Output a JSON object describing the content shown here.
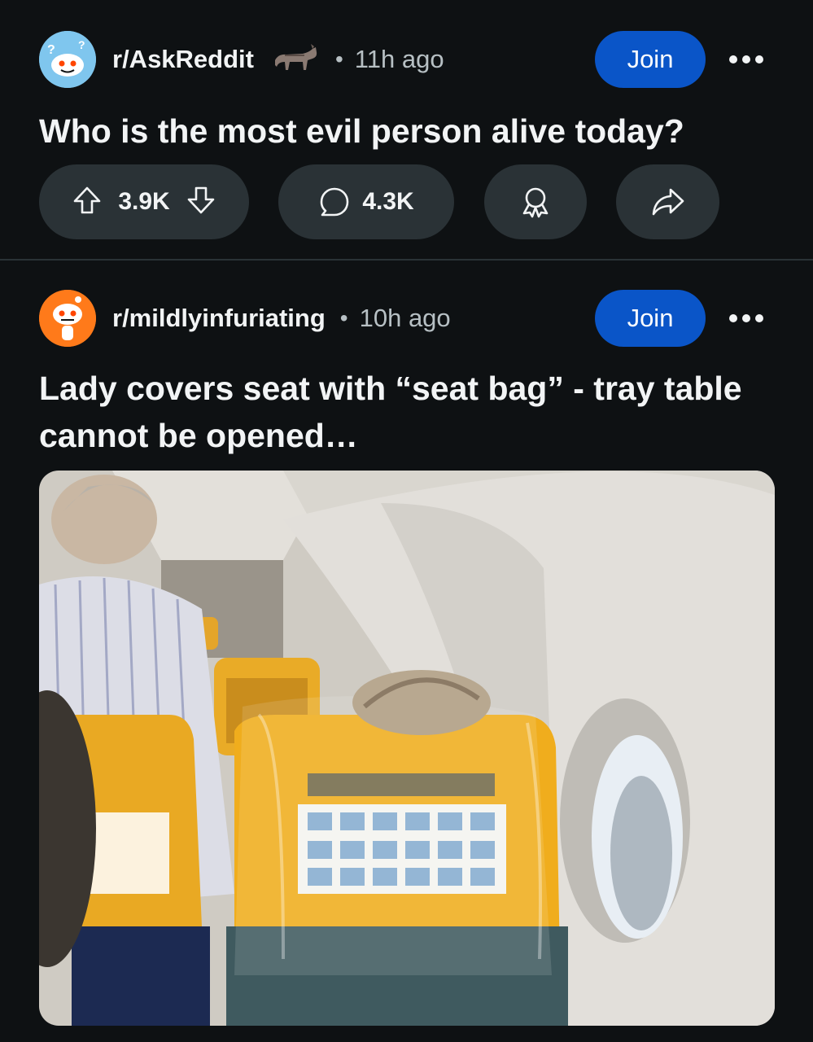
{
  "posts": [
    {
      "subreddit": "r/AskReddit",
      "time_separator": "•",
      "time": "11h ago",
      "join_label": "Join",
      "title": "Who is the most evil person alive today?",
      "upvotes": "3.9K",
      "comments": "4.3K"
    },
    {
      "subreddit": "r/mildlyinfuriating",
      "time_separator": "•",
      "time": "10h ago",
      "join_label": "Join",
      "title": "Lady covers seat with “seat bag” - tray table cannot be opened…"
    }
  ],
  "icons": {
    "upvote": "upvote-icon",
    "downvote": "downvote-icon",
    "comment": "comment-icon",
    "award": "award-icon",
    "share": "share-icon",
    "more": "more-icon",
    "flair": "donkey-flair-icon"
  },
  "colors": {
    "background": "#0e1113",
    "pill": "#2a3236",
    "join_button": "#0a55c8",
    "text_primary": "#f2f4f5",
    "text_secondary": "#b7c0c4"
  }
}
